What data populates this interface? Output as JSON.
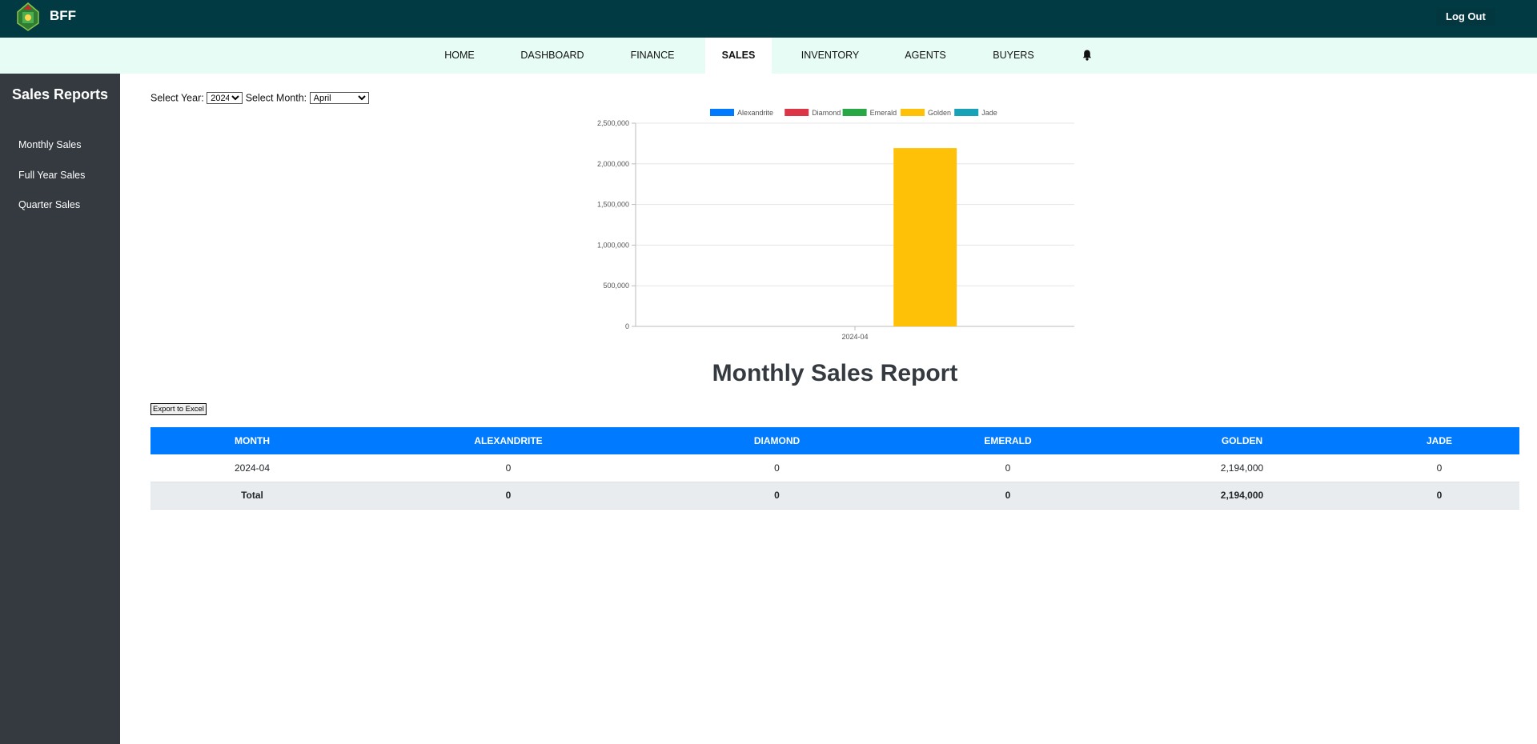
{
  "app": {
    "brand": "BFF",
    "logout_label": "Log Out"
  },
  "nav": {
    "items": [
      {
        "label": "HOME"
      },
      {
        "label": "DASHBOARD"
      },
      {
        "label": "FINANCE"
      },
      {
        "label": "SALES"
      },
      {
        "label": "INVENTORY"
      },
      {
        "label": "AGENTS"
      },
      {
        "label": "BUYERS"
      }
    ],
    "active": "SALES"
  },
  "sidebar": {
    "title": "Sales Reports",
    "items": [
      {
        "label": "Monthly Sales"
      },
      {
        "label": "Full Year Sales"
      },
      {
        "label": "Quarter Sales"
      }
    ]
  },
  "filters": {
    "year_label": "Select Year:",
    "year_value": "2024",
    "month_label": "Select Month:",
    "month_value": "April"
  },
  "report": {
    "title": "Monthly Sales Report",
    "export_label": "Export to Excel",
    "headers": [
      "MONTH",
      "ALEXANDRITE",
      "DIAMOND",
      "EMERALD",
      "GOLDEN",
      "JADE"
    ],
    "rows": [
      [
        "2024-04",
        "0",
        "0",
        "0",
        "2,194,000",
        "0"
      ]
    ],
    "total": [
      "Total",
      "0",
      "0",
      "0",
      "2,194,000",
      "0"
    ]
  },
  "chart_data": {
    "type": "bar",
    "categories": [
      "2024-04"
    ],
    "series": [
      {
        "name": "Alexandrite",
        "color": "#007bff",
        "values": [
          0
        ]
      },
      {
        "name": "Diamond",
        "color": "#dc3545",
        "values": [
          0
        ]
      },
      {
        "name": "Emerald",
        "color": "#28a745",
        "values": [
          0
        ]
      },
      {
        "name": "Golden",
        "color": "#ffc107",
        "values": [
          2194000
        ]
      },
      {
        "name": "Jade",
        "color": "#17a2b8",
        "values": [
          0
        ]
      }
    ],
    "ylim": [
      0,
      2500000
    ],
    "yticks": [
      "2,500,000",
      "2,000,000",
      "1,500,000",
      "1,000,000",
      "500,000",
      "0"
    ],
    "ytick_values": [
      2500000,
      2000000,
      1500000,
      1000000,
      500000,
      0
    ],
    "grid": true,
    "legend": "top"
  }
}
